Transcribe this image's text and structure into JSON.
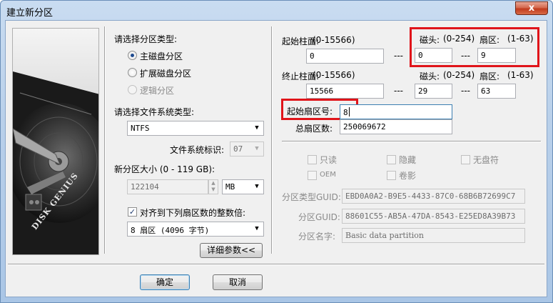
{
  "window": {
    "title": "建立新分区",
    "close_glyph": "x"
  },
  "left": {
    "partition_type_title": "请选择分区类型:",
    "partition_types": [
      {
        "label": "主磁盘分区",
        "checked": true,
        "disabled": false
      },
      {
        "label": "扩展磁盘分区",
        "checked": false,
        "disabled": false
      },
      {
        "label": "逻辑分区",
        "checked": false,
        "disabled": true
      }
    ],
    "fs_type_title": "请选择文件系统类型:",
    "fs_type_value": "NTFS",
    "fs_id_label": "文件系统标识:",
    "fs_id_value": "07",
    "size_label": "新分区大小 (0 - 119 GB):",
    "size_value": "122104",
    "size_unit": "MB",
    "align_label": "对齐到下列扇区数的整数倍:",
    "align_checked": true,
    "align_value": "8 扇区 (4096 字节)",
    "details_button": "详细参数<<"
  },
  "right": {
    "start_cyl_label": "起始柱面:",
    "start_cyl_range": "(0-15566)",
    "start_cyl_value": "0",
    "start_head_label": "磁头:",
    "start_head_range": "(0-254)",
    "start_head_value": "0",
    "start_sector_label": "扇区:",
    "start_sector_range": "(1-63)",
    "start_sector_value": "9",
    "end_cyl_label": "终止柱面:",
    "end_cyl_range": "(0-15566)",
    "end_cyl_value": "15566",
    "end_head_label": "磁头:",
    "end_head_range": "(0-254)",
    "end_head_value": "29",
    "end_sector_label": "扇区:",
    "end_sector_range": "(1-63)",
    "end_sector_value": "63",
    "dash": "---",
    "start_lba_label": "起始扇区号:",
    "start_lba_value": "8",
    "total_sectors_label": "总扇区数:",
    "total_sectors_value": "250069672",
    "attributes": {
      "readonly": "只读",
      "hidden": "隐藏",
      "no_drive_letter": "无盘符",
      "oem": "OEM",
      "shadow_copy": "卷影"
    },
    "type_guid_label": "分区类型GUID:",
    "type_guid_value": "EBD0A0A2-B9E5-4433-87C0-68B6B72699C7",
    "partition_guid_label": "分区GUID:",
    "partition_guid_value": "88601C55-AB5A-47DA-8543-E25ED8A39B73",
    "partition_name_label": "分区名字:",
    "partition_name_value": "Basic data partition"
  },
  "footer": {
    "ok_button": "确定",
    "cancel_button": "取消"
  },
  "image": {
    "brand_text": "DISK GENIUS"
  }
}
